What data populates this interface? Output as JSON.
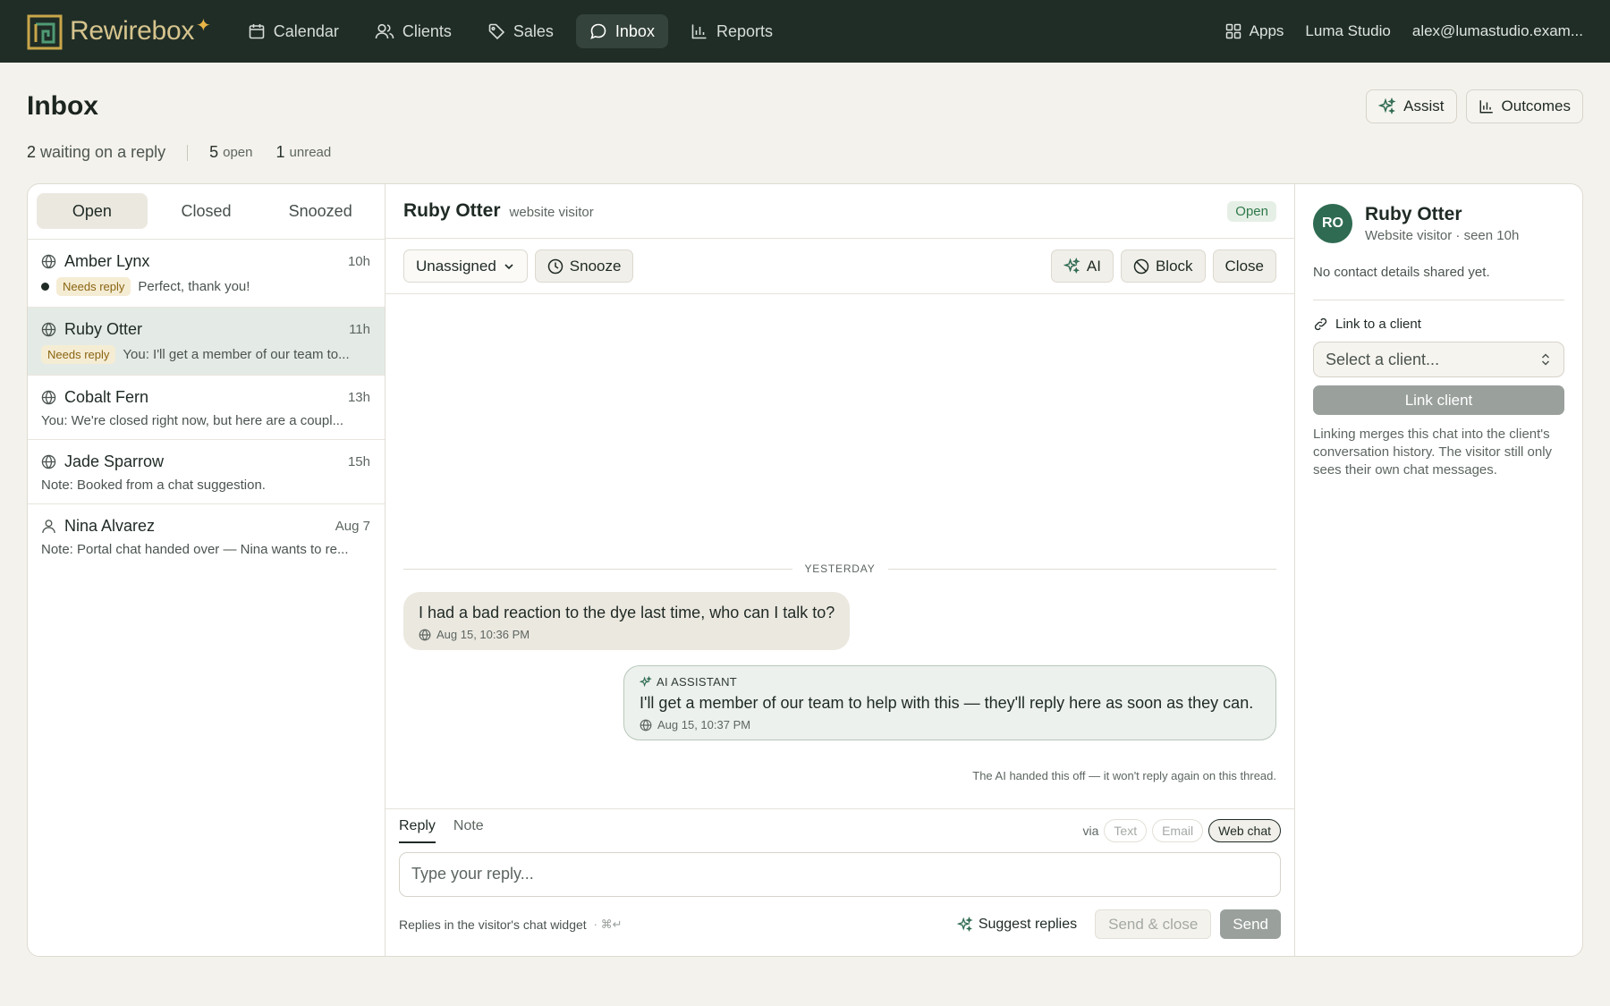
{
  "brand": {
    "name": "Rewirebox",
    "logo_icon": "rewirebox-logo-icon",
    "spark": "✦"
  },
  "nav": {
    "items": [
      {
        "label": "Calendar",
        "icon": "calendar-icon"
      },
      {
        "label": "Clients",
        "icon": "users-icon"
      },
      {
        "label": "Sales",
        "icon": "tag-icon"
      },
      {
        "label": "Inbox",
        "icon": "chat-bubble-icon",
        "active": true
      },
      {
        "label": "Reports",
        "icon": "bar-chart-icon"
      }
    ],
    "apps_label": "Apps",
    "studio": "Luma Studio",
    "account": "alex@lumastudio.exam..."
  },
  "header": {
    "title": "Inbox",
    "stats": {
      "waiting_count": "2",
      "waiting_label": "waiting on a reply",
      "open_count": "5",
      "open_label": "open",
      "unread_count": "1",
      "unread_label": "unread"
    },
    "assist_label": "Assist",
    "outcomes_label": "Outcomes"
  },
  "list": {
    "tabs": [
      "Open",
      "Closed",
      "Snoozed"
    ],
    "active_tab": "Open",
    "badge_label": "Needs reply",
    "conversations": [
      {
        "name": "Amber Lynx",
        "time": "10h",
        "preview": "Perfect, thank you!",
        "needs_reply": true,
        "unread": true,
        "icon": "globe-icon"
      },
      {
        "name": "Ruby Otter",
        "time": "11h",
        "preview": "You: I'll get a member of our team to...",
        "needs_reply": true,
        "unread": false,
        "selected": true,
        "icon": "globe-icon"
      },
      {
        "name": "Cobalt Fern",
        "time": "13h",
        "preview": "You: We're closed right now, but here are a coupl...",
        "needs_reply": false,
        "icon": "globe-icon"
      },
      {
        "name": "Jade Sparrow",
        "time": "15h",
        "preview": "Note: Booked from a chat suggestion.",
        "needs_reply": false,
        "icon": "globe-icon"
      },
      {
        "name": "Nina Alvarez",
        "time": "Aug 7",
        "preview": "Note: Portal chat handed over — Nina wants to re...",
        "needs_reply": false,
        "icon": "person-icon"
      }
    ]
  },
  "chat": {
    "name": "Ruby Otter",
    "subtitle": "website visitor",
    "status": "Open",
    "assignee": "Unassigned",
    "snooze_label": "Snooze",
    "ai_label": "AI",
    "block_label": "Block",
    "close_label": "Close",
    "day_divider": "YESTERDAY",
    "messages": [
      {
        "from": "visitor",
        "text": "I had a bad reaction to the dye last time, who can I talk to?",
        "time": "Aug 15, 10:36 PM"
      },
      {
        "from": "ai",
        "sender_label": "AI ASSISTANT",
        "text": "I'll get a member of our team to help with this — they'll reply here as soon as they can.",
        "time": "Aug 15, 10:37 PM"
      }
    ],
    "handoff_note": "The AI handed this off — it won't reply again on this thread."
  },
  "composer": {
    "tabs": [
      "Reply",
      "Note"
    ],
    "active_tab": "Reply",
    "via_label": "via",
    "channels": [
      "Text",
      "Email",
      "Web chat"
    ],
    "active_channel": "Web chat",
    "placeholder": "Type your reply...",
    "footer_note": "Replies in the visitor's chat widget",
    "shortcut": "· ⌘↵",
    "suggest_label": "Suggest replies",
    "send_close_label": "Send & close",
    "send_label": "Send"
  },
  "contact": {
    "initials": "RO",
    "avatar_color": "#2f6b52",
    "name": "Ruby Otter",
    "subtitle": "Website visitor · seen 10h",
    "no_details": "No contact details shared yet.",
    "link_title": "Link to a client",
    "select_placeholder": "Select a client...",
    "link_button": "Link client",
    "help": "Linking merges this chat into the client's conversation history. The visitor still only sees their own chat messages."
  },
  "colors": {
    "nav_bg": "#1f2d26",
    "brand": "#d6c48d",
    "accent_green": "#2f6b52",
    "needs_reply_bg": "#f5ecd4",
    "selected_row": "#e4ebe6"
  }
}
